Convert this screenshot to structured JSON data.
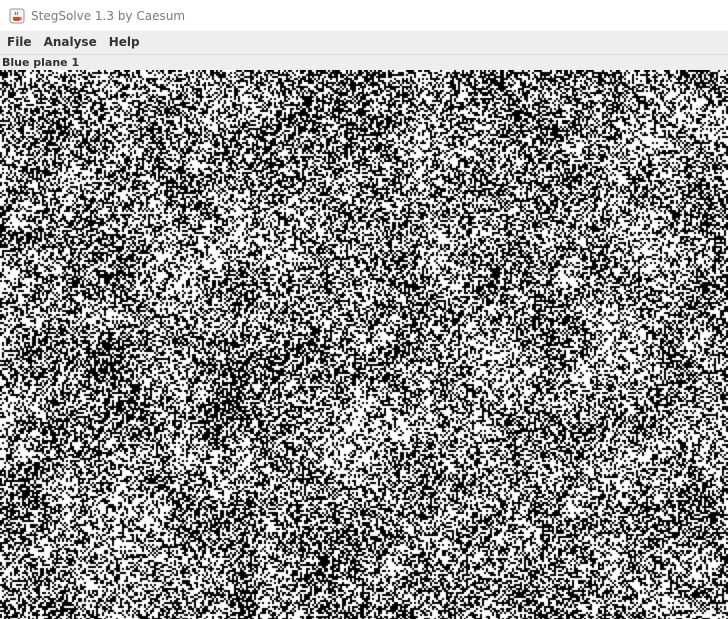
{
  "window": {
    "title": "StegSolve 1.3 by Caesum",
    "icon": "java-cup-icon"
  },
  "menu": {
    "items": [
      "File",
      "Analyse",
      "Help"
    ]
  },
  "panel": {
    "label": "Blue plane 1"
  },
  "image": {
    "description_colors": {
      "on": "#ffffff",
      "off": "#000000"
    }
  }
}
